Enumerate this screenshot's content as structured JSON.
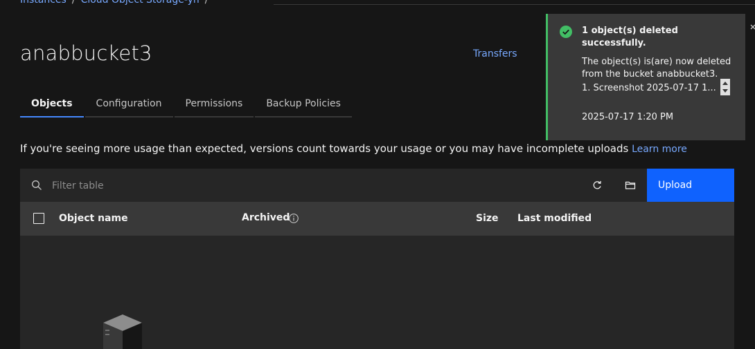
{
  "breadcrumb": {
    "items": [
      "Instances",
      "Cloud Object Storage-yn"
    ],
    "separator": "/"
  },
  "page": {
    "title": "anabbucket3",
    "transfers_label": "Transfers"
  },
  "tabs": [
    {
      "label": "Objects",
      "active": true
    },
    {
      "label": "Configuration",
      "active": false
    },
    {
      "label": "Permissions",
      "active": false
    },
    {
      "label": "Backup Policies",
      "active": false
    }
  ],
  "info": {
    "text": "If you're seeing more usage than expected, versions count towards your usage or you may have incomplete uploads",
    "link": "Learn more"
  },
  "toolbar": {
    "filter_placeholder": "Filter table",
    "refresh_icon": "refresh-icon",
    "folder_icon": "folder-icon",
    "upload_label": "Upload"
  },
  "table": {
    "columns": {
      "name": "Object name",
      "archived": "Archived",
      "size": "Size",
      "modified": "Last modified"
    }
  },
  "notification": {
    "title": "1 object(s) deleted successfully.",
    "body": "The object(s) is(are) now deleted from the bucket anabbucket3.",
    "item": "1. Screenshot 2025-07-17 1...",
    "timestamp": "2025-07-17 1:20 PM",
    "status_color": "#42be65"
  },
  "colors": {
    "accent": "#0f62fe",
    "link": "#78a9ff",
    "background": "#161616",
    "success": "#42be65"
  }
}
